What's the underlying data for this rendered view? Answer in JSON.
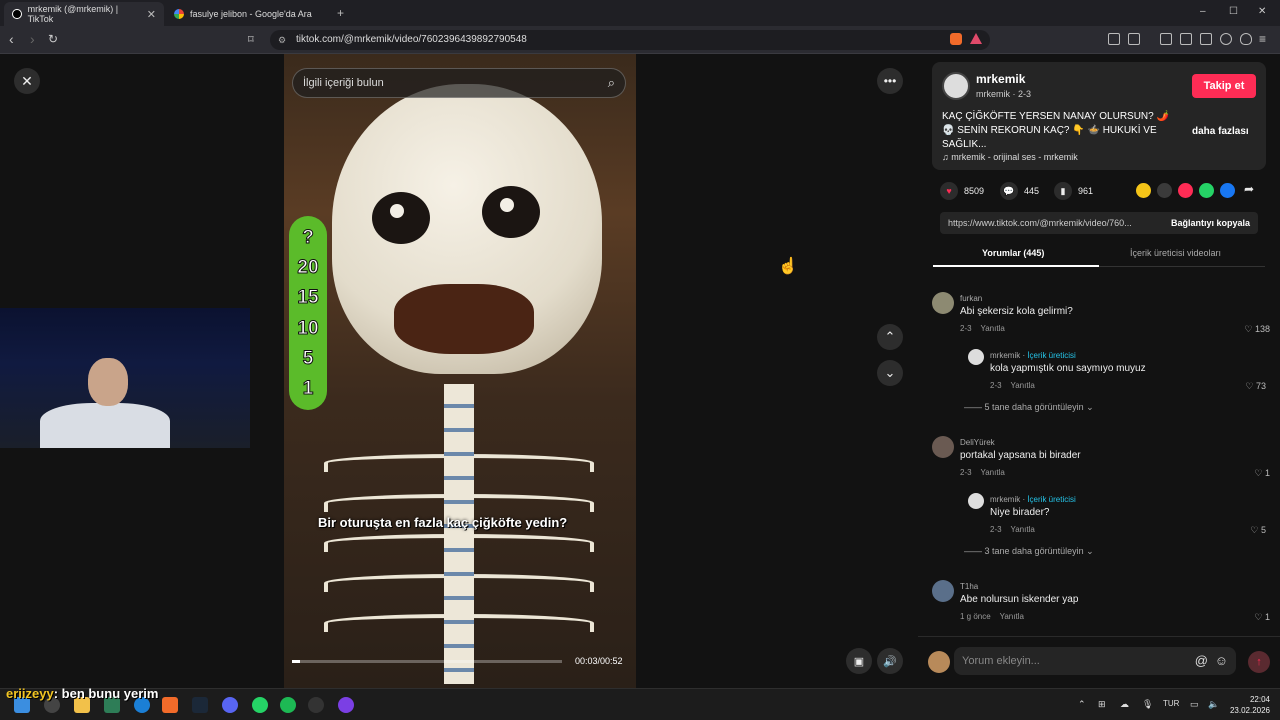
{
  "browser": {
    "tabs": [
      {
        "title": "mrkemik (@mrkemik) | TikTok",
        "close": "✕"
      },
      {
        "title": "fasulye jelibon - Google'da Ara",
        "close": "✕"
      }
    ],
    "new_tab": "+",
    "url": "tiktok.com/@mrkemik/video/7602396439892790548",
    "window_controls": [
      "–",
      "☐",
      "✕"
    ]
  },
  "video": {
    "search_placeholder": "İlgili içeriği bulun",
    "score_labels": [
      "?",
      "20",
      "15",
      "10",
      "5",
      "1"
    ],
    "caption": "Bir oturuşta en fazla kaç çiğköfte yedin?",
    "time": "00:03/00:52",
    "progress": 0.03
  },
  "post": {
    "username": "mrkemik",
    "subline": "mrkemik · 2-3",
    "follow_label": "Takip et",
    "description": "KAÇ ÇİĞKÖFTE YERSEN NANAY OLURSUN? 🌶️ 💀 SENİN REKORUN KAÇ? 👇 🍲 HUKUKİ VE SAĞLIK...",
    "more_label": "daha fazlası",
    "sound": "mrkemik - orijinal ses - mrkemik",
    "likes": "8509",
    "comments": "445",
    "saves": "961",
    "link": "https://www.tiktok.com/@mrkemik/video/760...",
    "copy_label": "Bağlantıyı kopyala"
  },
  "panel_tabs": [
    "Yorumlar (445)",
    "İçerik üreticisi videoları"
  ],
  "comments": [
    {
      "name": "furkan",
      "text": "Abi şekersiz kola gelirmi?",
      "date": "2-3",
      "reply": "Yanıtla",
      "likes": "138"
    },
    {
      "name": "mrkemik",
      "badge": "İçerik üreticisi",
      "text": "kola yapmıştık onu saymıyo muyuz",
      "date": "2-3",
      "reply": "Yanıtla",
      "likes": "73"
    },
    {
      "name": "DeliYürek",
      "text": "portakal yapsana bi birader",
      "date": "2-3",
      "reply": "Yanıtla",
      "likes": "1"
    },
    {
      "name": "mrkemik",
      "badge": "İçerik üreticisi",
      "text": "Niye birader?",
      "date": "2-3",
      "reply": "Yanıtla",
      "likes": "5"
    },
    {
      "name": "T1ha",
      "text": "Abe nolursun iskender yap",
      "date": "1 g önce",
      "reply": "Yanıtla",
      "likes": "1"
    }
  ],
  "view_more": [
    "5 tane daha görüntüleyin",
    "3 tane daha görüntüleyin"
  ],
  "comment_placeholder": "Yorum ekleyin...",
  "stream_overlay": {
    "user": "eriizeyy",
    "message": ": ben bunu yerim"
  },
  "taskbar": {
    "lang": "TUR",
    "time": "22:04",
    "date": "23.02.2026"
  },
  "colors": {
    "accent": "#fe2c55",
    "creator": "#25c4e8",
    "score_bar": "#5bbb2a"
  }
}
